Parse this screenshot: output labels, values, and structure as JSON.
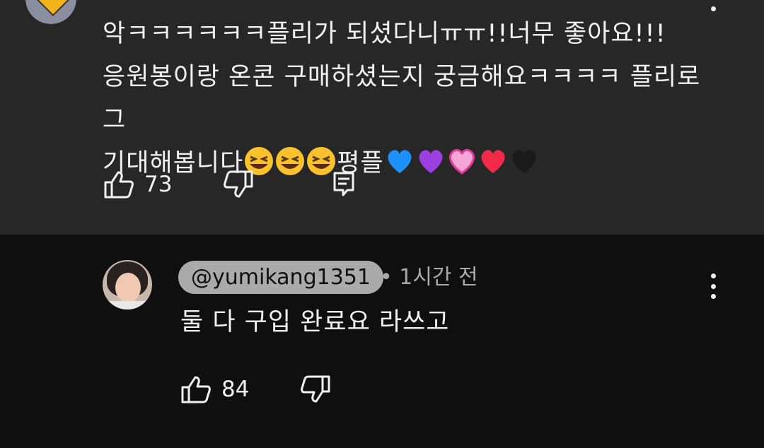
{
  "top_comment": {
    "text_line1": "악ㅋㅋㅋㅋㅋㅋ플리가 되셨다니ㅠㅠ!!너무 좋아요!!!",
    "text_line2": "응원봉이랑 온콘 구매하셨는지 궁금해요ㅋㅋㅋㅋ 플리로그",
    "text_line3_prefix": "기대해봅니다",
    "text_line3_mid": "평플",
    "emojis": [
      "laughing-face",
      "laughing-face",
      "laughing-face",
      "blue-heart",
      "purple-heart",
      "pink-heart",
      "red-heart",
      "black-heart"
    ],
    "like_count": "73"
  },
  "reply": {
    "author": "@yumikang1351",
    "meta": "• 1시간 전",
    "text": "둘 다 구입 완료요 라쓰고",
    "like_count": "84"
  },
  "colors": {
    "top_bg": "#272727",
    "reply_bg": "#0f0f0f",
    "chip_bg": "#aaaaaa",
    "text": "#f1f1f1"
  }
}
